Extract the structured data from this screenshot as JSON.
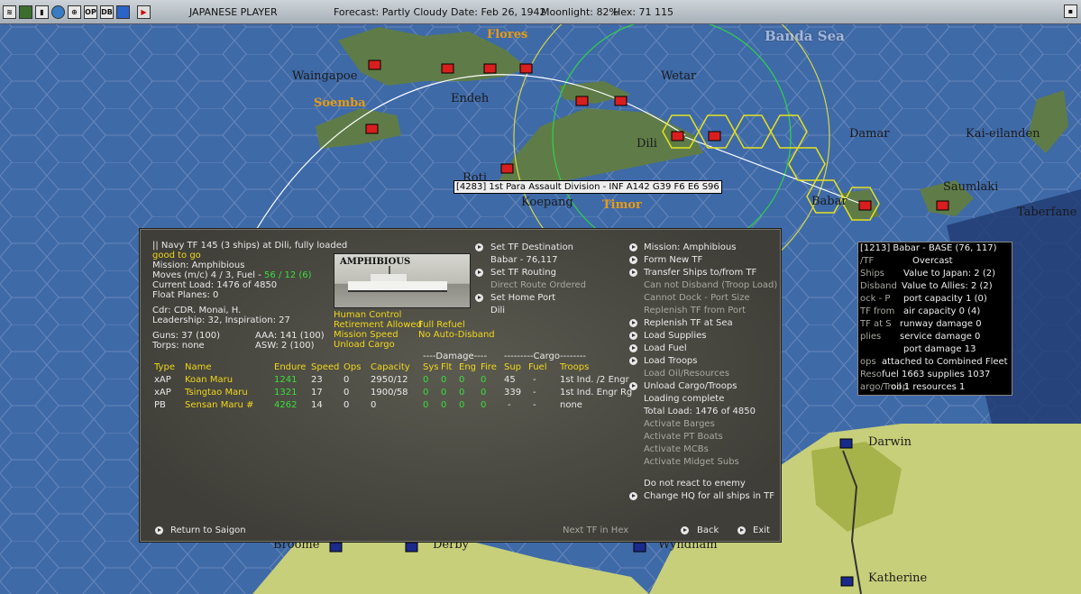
{
  "topbar": {
    "player": "JAPANESE PLAYER",
    "forecast": "Forecast: Partly Cloudy",
    "date": "Date: Feb 26, 1942",
    "moonlight": "Moonlight: 82%",
    "hex": "Hex: 71 115",
    "icons": [
      "save-icon",
      "screen-icon",
      "chart-icon",
      "globe-icon",
      "target-icon",
      "op-icon",
      "db-icon",
      "window-icon",
      "end-turn-icon"
    ],
    "icon_text": {
      "op": "OP",
      "db": "DB"
    }
  },
  "map": {
    "labels": {
      "flores": "Flores",
      "banda": "Banda Sea",
      "waingapoe": "Waingapoe",
      "soemba": "Soemba",
      "endeh": "Endeh",
      "wetar": "Wetar",
      "dili": "Dili",
      "damar": "Damar",
      "kai": "Kai-eilanden",
      "roti": "Roti",
      "koepang": "Koepang",
      "timor": "Timor",
      "babar": "Babar",
      "saumlaki": "Saumlaki",
      "taberfane": "Taberfane",
      "darwin": "Darwin",
      "broome": "Broome",
      "derby": "Derby",
      "wyndham": "Wyndham",
      "katherine": "Katherine"
    },
    "unit_label": "[4283] 1st Para Assault Division - INF   A142 G39 F6 E6 S96"
  },
  "tf_panel": {
    "title": "|| Navy TF 145 (3 ships) at Dili, fully loaded",
    "status": "good to go",
    "mission": "Mission: Amphibious",
    "moves_prefix": "Moves (m/c) 4 / 3, Fuel - ",
    "moves_fuel": "56 / 12 (6)",
    "current_load": "Current Load: 1476 of 4850",
    "float_planes": "Float Planes: 0",
    "cdr": "Cdr: CDR. Monai, H.",
    "leadership": "Leadership: 32, Inspiration: 27",
    "guns": "Guns: 37 (100)",
    "aaa": "AAA: 141 (100)",
    "torps": "Torps: none",
    "asw": "ASW: 2 (100)",
    "photo_title": "AMPHIBIOUS",
    "options": {
      "human_control": "Human Control",
      "retirement": "Retirement Allowed",
      "full_refuel": "Full Refuel",
      "mission_speed": "Mission Speed",
      "no_auto_disband": "No Auto-Disband",
      "unload_cargo": "Unload Cargo"
    },
    "middle_menu": {
      "set_destination": "Set TF Destination",
      "destination_value": "Babar - 76,117",
      "set_routing": "Set TF Routing",
      "direct_route": "Direct Route Ordered",
      "set_home_port": "Set Home Port",
      "home_port_value": "Dili"
    },
    "right_menu": {
      "mission": "Mission: Amphibious",
      "form_new": "Form New TF",
      "transfer": "Transfer Ships to/from TF",
      "cannot_disband": "Can not Disband (Troop Load)",
      "cannot_dock": "Cannot Dock - Port Size",
      "replenish_port": "Replenish TF from Port",
      "replenish_sea": "Replenish TF at Sea",
      "load_supplies": "Load Supplies",
      "load_fuel": "Load Fuel",
      "load_troops": "Load Troops",
      "load_oil": "Load Oil/Resources",
      "unload": "Unload Cargo/Troops",
      "loading_complete": "Loading complete",
      "total_load": "Total Load: 1476 of 4850",
      "barges": "Activate Barges",
      "pt_boats": "Activate PT Boats",
      "mcbs": "Activate MCBs",
      "midget_subs": "Activate Midget Subs",
      "not_react": "Do not react to enemy",
      "change_hq": "Change HQ for all ships in TF"
    },
    "group_headers": {
      "damage": "----Damage----",
      "cargo": "---------Cargo--------"
    },
    "columns": [
      "Type",
      "Name",
      "Endure",
      "Speed",
      "Ops",
      "Capacity",
      "Sys",
      "Flt",
      "Eng",
      "Fire",
      "Sup",
      "Fuel",
      "Troops"
    ],
    "ships": [
      {
        "type": "xAP",
        "name": "Koan Maru",
        "endure": "1241",
        "speed": "23",
        "ops": "0",
        "capacity": "2950/12",
        "sys": "0",
        "flt": "0",
        "eng": "0",
        "fire": "0",
        "sup": "45",
        "fuel": "-",
        "troops": "1st Ind. /2 Engr"
      },
      {
        "type": "xAP",
        "name": "Tsingtao Maru",
        "endure": "1321",
        "speed": "17",
        "ops": "0",
        "capacity": "1900/58",
        "sys": "0",
        "flt": "0",
        "eng": "0",
        "fire": "0",
        "sup": "339",
        "fuel": "-",
        "troops": "1st Ind. Engr Rg"
      },
      {
        "type": "PB",
        "name": "Sensan Maru #",
        "endure": "4262",
        "speed": "14",
        "ops": "0",
        "capacity": "0",
        "sys": "0",
        "flt": "0",
        "eng": "0",
        "fire": "0",
        "sup": "-",
        "fuel": "-",
        "troops": "none"
      }
    ],
    "footer": {
      "return": "Return to Saigon",
      "next_tf": "Next TF in Hex",
      "back": "Back",
      "exit": "Exit"
    }
  },
  "base_popup": {
    "title": "[1213] Babar  - BASE (76, 117)",
    "weather": "Overcast",
    "lines": [
      "Value to Japan: 2 (2)",
      "Value to Allies: 2 (2)",
      "port capacity 1 (0)",
      "air capacity 0 (4)",
      "runway damage 0",
      "service damage 0",
      "port damage 13",
      "attached to Combined Fleet",
      "fuel 1663  supplies 1037",
      "oil 1  resources 1"
    ],
    "bg_fragments": [
      "/TF",
      "Ships",
      "Disband",
      "ock - P",
      "TF from",
      "TF at S",
      "plies",
      "ops",
      "Reso",
      "argo/Troop"
    ]
  },
  "colors": {
    "ocean": "#3f6aa8",
    "land": "#6c8a52",
    "australia": "#c7cf7a",
    "panel": "#4c4b44",
    "highlight": "#f2d71a",
    "green": "#3adf3a",
    "japan_flag": "#d81e1e"
  }
}
